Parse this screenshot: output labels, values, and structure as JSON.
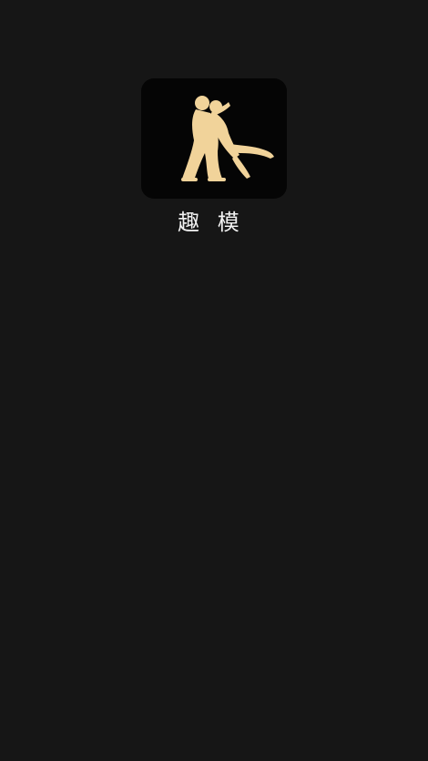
{
  "splash": {
    "app_name": "趣 模",
    "logo_icon": "dancing-couple-icon",
    "colors": {
      "background": "#161616",
      "logo_background": "#050505",
      "silhouette": "#f1d39a",
      "text": "#f2f2f2"
    }
  }
}
